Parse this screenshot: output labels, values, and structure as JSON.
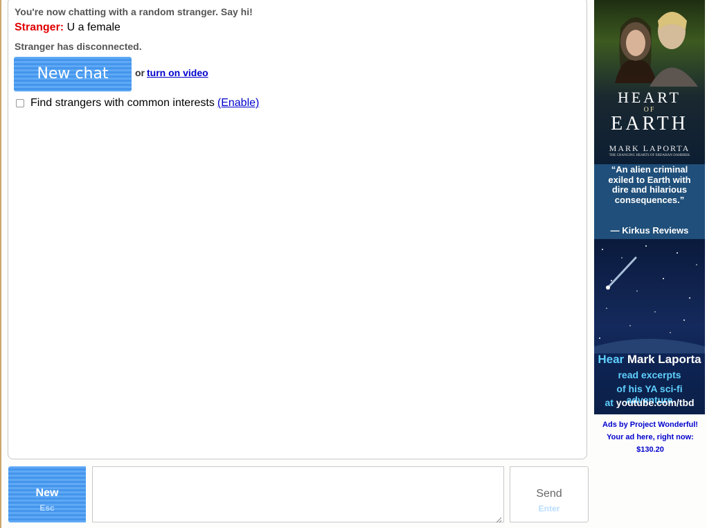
{
  "chat": {
    "connected_msg": "You're now chatting with a random stranger. Say hi!",
    "stranger_label": "Stranger:",
    "stranger_text": " U a female",
    "disconnected_msg": "Stranger has disconnected.",
    "new_chat_label": "New chat",
    "or_text": "or",
    "video_link": "turn on video",
    "interests_text": "Find strangers with common interests",
    "interests_link": "(Enable)"
  },
  "controls": {
    "new_label": "New",
    "new_key": "Esc",
    "send_label": "Send",
    "send_key": "Enter",
    "message_value": ""
  },
  "ad": {
    "title_1": "HEART",
    "title_2": "OF",
    "title_3": "EARTH",
    "author": "MARK LAPORTA",
    "series": "THE CHANGING HEARTS OF ERDAHAN DAHBREK",
    "quote": "“An alien criminal exiled to Earth with dire and hilarious consequences.”",
    "review_source": "— Kirkus Reviews",
    "hear_prefix": "Hear",
    "hear_name": " Mark Laporta",
    "line_2": "read excerpts",
    "line_3": "of his YA sci-fi adventure",
    "line_4_prefix": "at ",
    "line_4_url": "youtube.com/tbd",
    "credit": "Ads by Project Wonderful! Your ad here, right now: $130.20"
  },
  "colors": {
    "stranger": "#e00000",
    "button_blue": "#4495ec",
    "link": "#0000cc"
  }
}
